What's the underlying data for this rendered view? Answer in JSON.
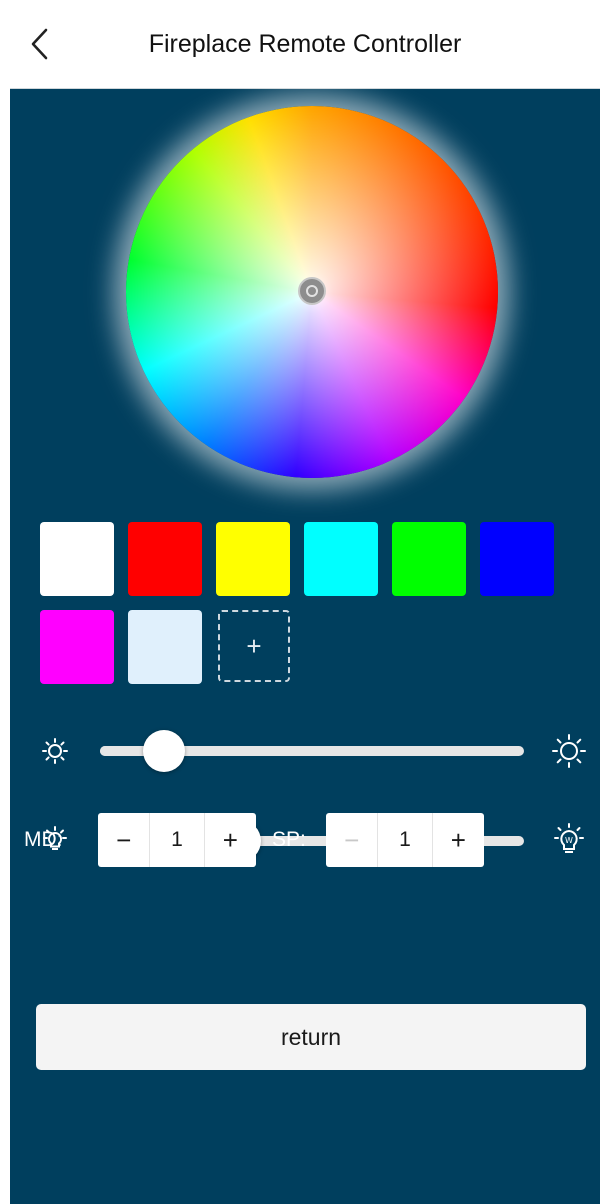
{
  "header": {
    "title": "Fireplace Remote Controller",
    "back_icon": "chevron-left-icon"
  },
  "color_wheel": {
    "type": "hue-saturation-wheel",
    "glow_color": "#ffffff"
  },
  "swatches": [
    {
      "name": "white",
      "color": "#ffffff"
    },
    {
      "name": "red",
      "color": "#ff0000"
    },
    {
      "name": "yellow",
      "color": "#ffff00"
    },
    {
      "name": "cyan",
      "color": "#00ffff"
    },
    {
      "name": "green",
      "color": "#00ff00"
    },
    {
      "name": "blue",
      "color": "#0000ff"
    },
    {
      "name": "magenta",
      "color": "#ff00ff"
    },
    {
      "name": "pale-blue",
      "color": "#e0f0fc"
    }
  ],
  "add_swatch": {
    "label": "+"
  },
  "brightness": {
    "low_icon": "sun-small-icon",
    "high_icon": "sun-large-icon",
    "value": 0.15,
    "fill_color": "#e6e6e6"
  },
  "white_level": {
    "low_icon": "bulb-small-icon",
    "high_icon": "bulb-w-icon",
    "value": 0.33,
    "fill_color": "#f5c071"
  },
  "mode": {
    "label": "MD:",
    "minus": "−",
    "value": "1",
    "plus": "+"
  },
  "speed": {
    "label": "SP:",
    "minus": "−",
    "value": "1",
    "plus": "+"
  },
  "return_button": {
    "label": "return"
  },
  "theme": {
    "background": "#003f5e",
    "header": "#ffffff"
  }
}
